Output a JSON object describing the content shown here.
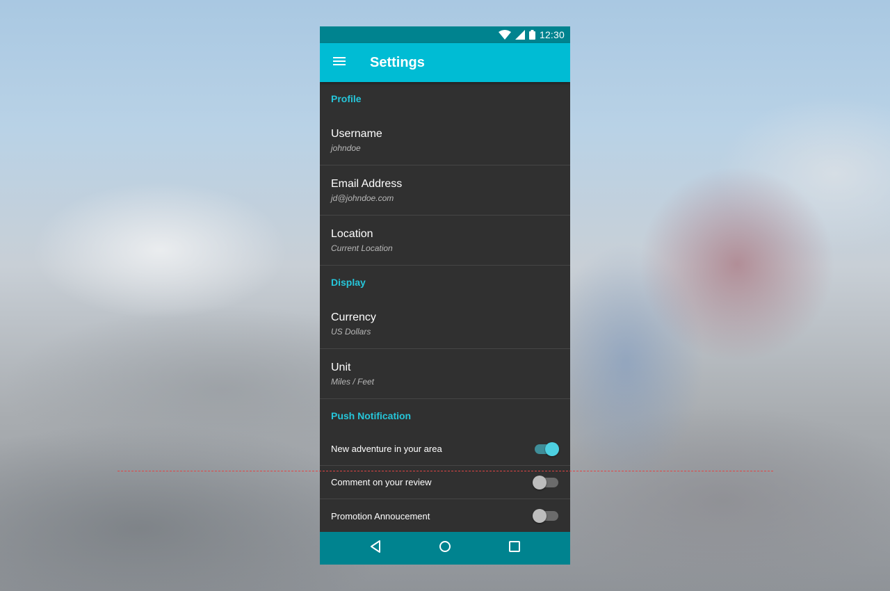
{
  "status_bar": {
    "time": "12:30"
  },
  "app_bar": {
    "title": "Settings"
  },
  "sections": {
    "profile": {
      "header": "Profile",
      "username": {
        "title": "Username",
        "value": "johndoe"
      },
      "email": {
        "title": "Email Address",
        "value": "jd@johndoe.com"
      },
      "location": {
        "title": "Location",
        "value": "Current Location"
      }
    },
    "display": {
      "header": "Display",
      "currency": {
        "title": "Currency",
        "value": "US Dollars"
      },
      "unit": {
        "title": "Unit",
        "value": "Miles / Feet"
      }
    },
    "push": {
      "header": "Push Notification",
      "items": [
        {
          "label": "New adventure in your area",
          "on": true
        },
        {
          "label": "Comment on your review",
          "on": false
        },
        {
          "label": "Promotion Annoucement",
          "on": false
        }
      ]
    }
  },
  "icons": {
    "menu": "menu-icon",
    "wifi": "wifi-icon",
    "signal": "signal-icon",
    "battery": "battery-icon",
    "back": "back-icon",
    "home": "home-icon",
    "recents": "recents-icon"
  },
  "colors": {
    "primary": "#00bcd4",
    "primary_dark": "#00838f",
    "accent": "#26c6da",
    "surface": "#303030"
  }
}
